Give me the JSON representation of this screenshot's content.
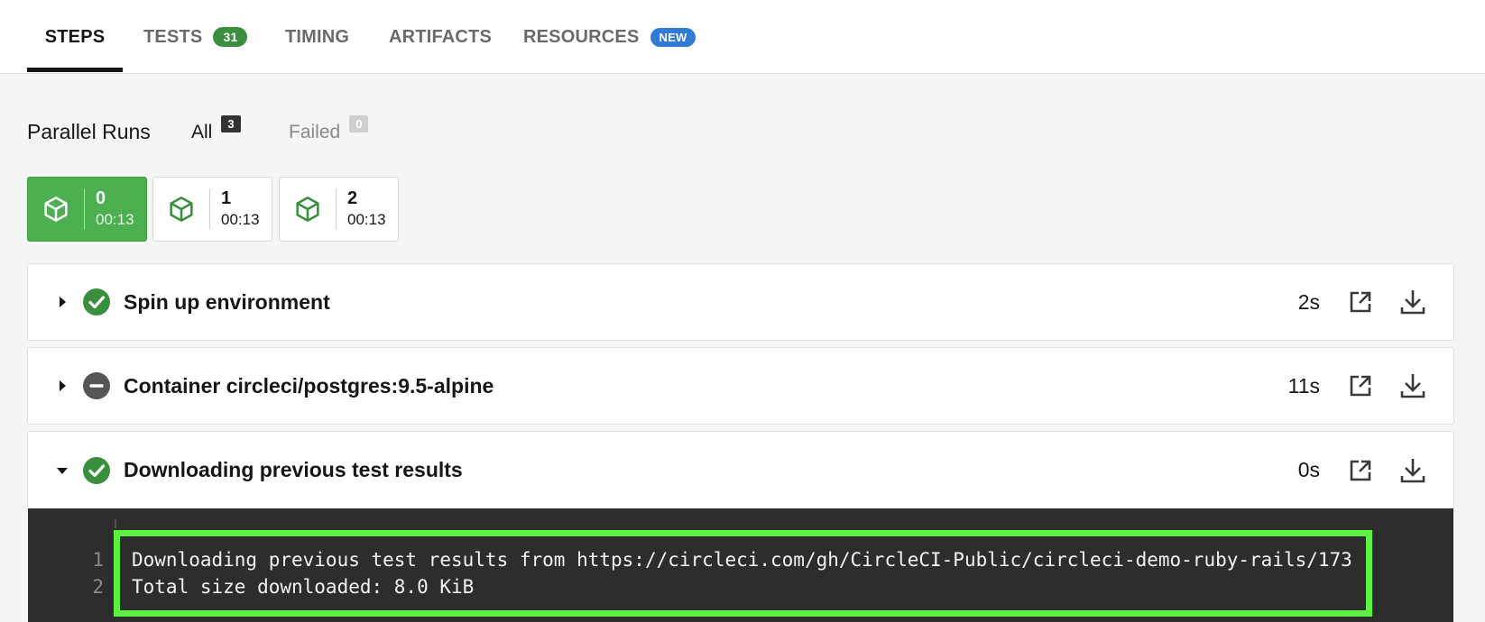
{
  "tabs": [
    {
      "label": "STEPS"
    },
    {
      "label": "TESTS",
      "badge": "31"
    },
    {
      "label": "TIMING"
    },
    {
      "label": "ARTIFACTS"
    },
    {
      "label": "RESOURCES",
      "badge": "NEW"
    }
  ],
  "parallel_runs": {
    "title": "Parallel Runs",
    "filters": [
      {
        "label": "All",
        "count": "3"
      },
      {
        "label": "Failed",
        "count": "0"
      }
    ],
    "runs": [
      {
        "index": "0",
        "time": "00:13",
        "selected": true
      },
      {
        "index": "1",
        "time": "00:13",
        "selected": false
      },
      {
        "index": "2",
        "time": "00:13",
        "selected": false
      }
    ]
  },
  "steps": [
    {
      "label": "Spin up environment",
      "duration": "2s",
      "status": "success",
      "expanded": false
    },
    {
      "label": "Container circleci/postgres:9.5-alpine",
      "duration": "11s",
      "status": "neutral",
      "expanded": false
    },
    {
      "label": "Downloading previous test results",
      "duration": "0s",
      "status": "success",
      "expanded": true
    }
  ],
  "log": {
    "lines": [
      {
        "num": "1",
        "text": "Downloading previous test results from https://circleci.com/gh/CircleCI-Public/circleci-demo-ruby-rails/173"
      },
      {
        "num": "2",
        "text": "Total size downloaded: 8.0 KiB"
      }
    ]
  },
  "colors": {
    "success": "#3a8f3f",
    "selected_run": "#4caf50",
    "neutral": "#555555",
    "new_badge": "#2f7bd5",
    "highlight": "#5cf040"
  }
}
